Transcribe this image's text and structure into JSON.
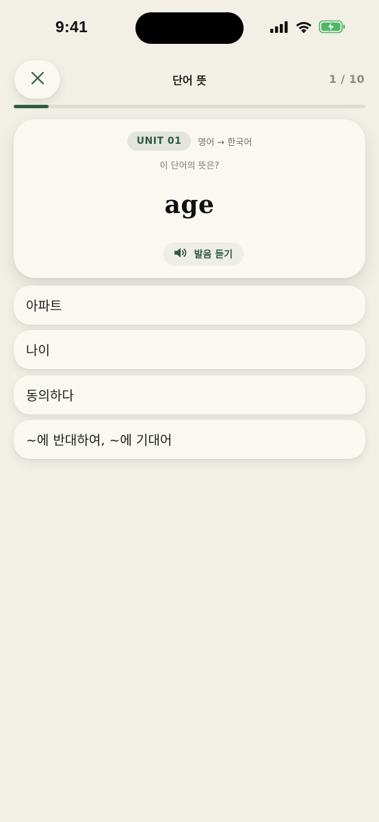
{
  "status_bar": {
    "time": "9:41",
    "icons": [
      "cellular-signal-icon",
      "wifi-icon",
      "battery-charging-icon"
    ]
  },
  "header": {
    "close_icon": "close-icon",
    "title": "단어 뜻",
    "progress_text": "1 / 10",
    "progress_fraction": 0.1
  },
  "card": {
    "unit_badge": "UNIT 01",
    "direction": "영어 → 한국어",
    "question": "이 단어의 뜻은?",
    "word": "age",
    "audio_icon": "speaker-icon",
    "audio_label": "발음 듣기"
  },
  "choices": [
    {
      "label": "아파트"
    },
    {
      "label": "나이"
    },
    {
      "label": "동의하다"
    },
    {
      "label": "~에 반대하여, ~에 기대어"
    }
  ],
  "colors": {
    "background": "#f2efe6",
    "card": "#faf8f1",
    "accent": "#2f5d45",
    "badge_bg": "#e3e5dc",
    "muted_text": "#8b8a84"
  }
}
